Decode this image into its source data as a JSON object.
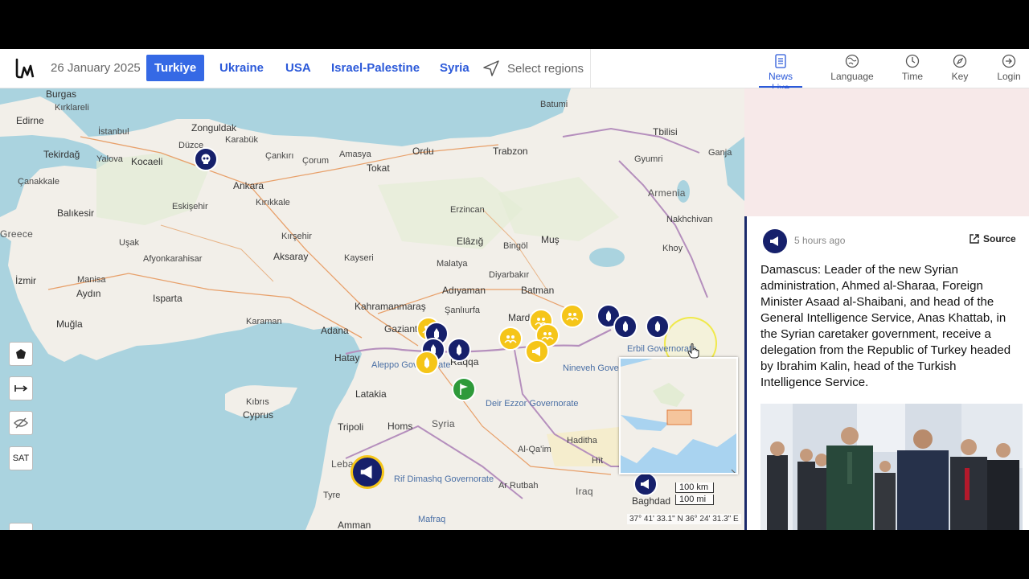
{
  "header": {
    "date": "26 January 2025",
    "regions": [
      "Turkiye",
      "Ukraine",
      "USA",
      "Israel-Palestine",
      "Syria"
    ],
    "active_region": "Turkiye",
    "select_regions_label": "Select regions",
    "nav": [
      {
        "label": "News Live",
        "icon": "news-icon"
      },
      {
        "label": "Language",
        "icon": "language-icon"
      },
      {
        "label": "Time",
        "icon": "clock-icon"
      },
      {
        "label": "Key",
        "icon": "compass-icon"
      },
      {
        "label": "Login",
        "icon": "login-icon"
      }
    ]
  },
  "map": {
    "places": [
      "Burgas",
      "Kırklareli",
      "Edirne",
      "Tekirdağ",
      "İstanbul",
      "Zonguldak",
      "Düzce",
      "Karabük",
      "Kocaeli",
      "Yalova",
      "Çanakkale",
      "Çankırı",
      "Ankara",
      "Kırıkkale",
      "Eskişehir",
      "Balıkesir",
      "Greece",
      "Uşak",
      "Afyonkarahisar",
      "Kırşehir",
      "Aksaray",
      "Kayseri",
      "Amasya",
      "Çorum",
      "Tokat",
      "Ordu",
      "Trabzon",
      "Batumi",
      "Tbilisi",
      "Ganja",
      "Gyumri",
      "Armenia",
      "Nakhchivan",
      "Erzincan",
      "Elâzığ",
      "Bingöl",
      "Muş",
      "Malatya",
      "Adıyaman",
      "Diyarbakır",
      "Batman",
      "Khoy",
      "İzmir",
      "Aydın",
      "Manisa",
      "Isparta",
      "Muğla",
      "Karaman",
      "Kahramanmaraş",
      "Gaziantep",
      "Şanlıurfa",
      "Mardin",
      "Adana",
      "Hatay",
      "Latakia",
      "Aleppo Governorate",
      "Raqqa",
      "Nineveh Governorate",
      "Erbil Governorate",
      "Kıbrıs",
      "Cyprus",
      "Tripoli",
      "Homs",
      "Syria",
      "Deir Ezzor Governorate",
      "Al-Qa'im",
      "Haditha",
      "Hīt",
      "Lebanon",
      "Rif Dimashq Governorate",
      "Tyre",
      "Ar Rutbah",
      "Iraq",
      "Baghdad",
      "Mafraq",
      "Amman"
    ],
    "controls": {
      "satellite_label": "SAT",
      "zoom_in": "+",
      "zoom_out": "−"
    },
    "scale": {
      "km": "100 km",
      "mi": "100 mi"
    },
    "coords": "37° 41' 33.1\" N 36° 24' 31.3\" E"
  },
  "article": {
    "time": "5 hours ago",
    "source_label": "Source",
    "text": "Damascus: Leader of the new Syrian administration, Ahmed al-Sharaa, Foreign Minister Asaad al-Shaibani, and head of the General Intelligence Service, Anas Khattab, in the Syrian caretaker government, receive a delegation from the Republic of Turkey headed by Ibrahim Kalin, head of the Turkish Intelligence Service."
  },
  "colors": {
    "accent": "#3569e5",
    "navy": "#16206b",
    "marker_yellow": "#f5c518",
    "marker_green": "#2e9a3a"
  }
}
